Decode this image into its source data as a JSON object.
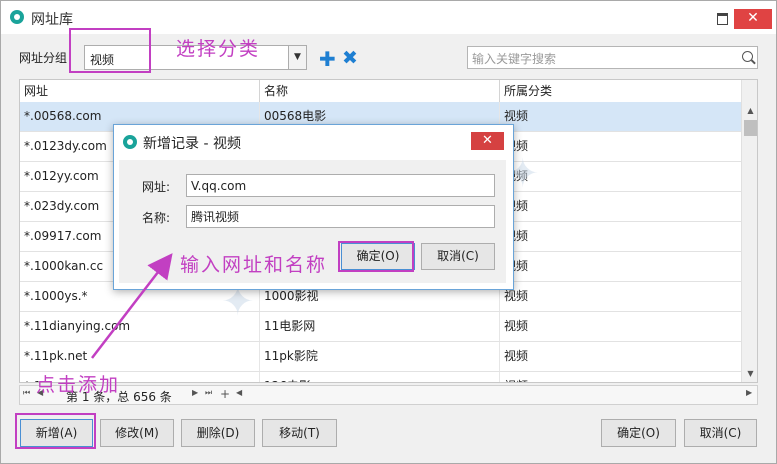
{
  "window": {
    "title": "网址库",
    "maximize_icon": "maximize-icon",
    "close_icon": "close-icon",
    "close_glyph": "✕"
  },
  "toolbar": {
    "group_label": "网址分组：",
    "group_value": "视频",
    "add_glyph": "✚",
    "delete_glyph": "✖",
    "search_placeholder": "输入关键字搜索"
  },
  "table": {
    "headers": [
      "网址",
      "名称",
      "所属分类"
    ],
    "rows": [
      {
        "url": "*.00568.com",
        "name": "00568电影",
        "category": "视频"
      },
      {
        "url": "*.0123dy.com",
        "name": "",
        "category": "视频"
      },
      {
        "url": "*.012yy.com",
        "name": "",
        "category": "视频"
      },
      {
        "url": "*.023dy.com",
        "name": "",
        "category": "视频"
      },
      {
        "url": "*.09917.com",
        "name": "",
        "category": "视频"
      },
      {
        "url": "*.1000kan.cc",
        "name": "",
        "category": "视频"
      },
      {
        "url": "*.1000ys.*",
        "name": "1000影视",
        "category": "视频"
      },
      {
        "url": "*.11dianying.com",
        "name": "11电影网",
        "category": "视频"
      },
      {
        "url": "*.11pk.net",
        "name": "11pk影院",
        "category": "视频"
      },
      {
        "url": "*.1",
        "name": "126电影",
        "category": "视频"
      }
    ]
  },
  "pager": {
    "text": "第 1 条，总 656 条",
    "first": "⏮",
    "prev": "◀",
    "next": "▶",
    "last": "⏭",
    "add": "+"
  },
  "buttons": {
    "add": "新增(A)",
    "edit": "修改(M)",
    "delete": "删除(D)",
    "move": "移动(T)",
    "ok": "确定(O)",
    "cancel": "取消(C)"
  },
  "dialog": {
    "title": "新增记录 - 视频",
    "url_label": "网址:",
    "url_value": "V.qq.com",
    "name_label": "名称:",
    "name_value": "腾讯视频",
    "ok": "确定(O)",
    "cancel": "取消(C)",
    "close_glyph": "✕"
  },
  "annotations": {
    "select_category": "选择分类",
    "input_url_name": "输入网址和名称",
    "click_add": "点击添加",
    "highlight_color": "#c23fc2"
  },
  "colors": {
    "accent": "#1e7fd2",
    "selected_row": "#d5e6f7",
    "close_red": "#e04343"
  }
}
